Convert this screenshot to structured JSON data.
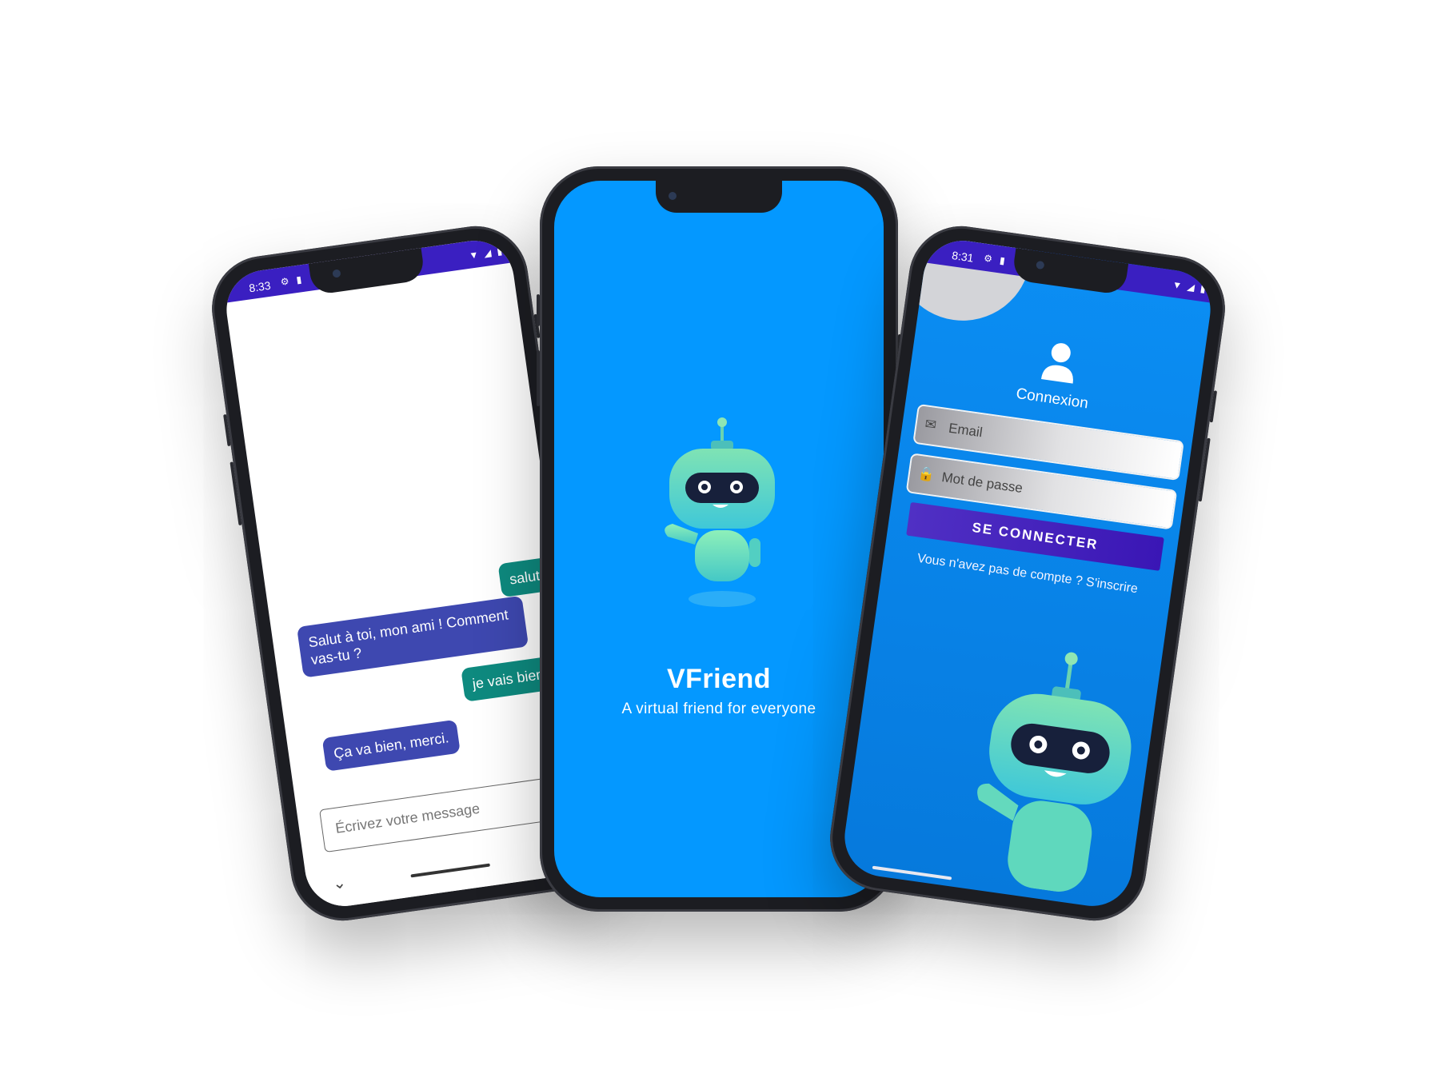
{
  "chat_screen": {
    "status": {
      "time": "8:33"
    },
    "messages": [
      {
        "from": "user",
        "text": "salut mo"
      },
      {
        "from": "bot",
        "text": "Salut à toi, mon ami ! Comment vas-tu ?"
      },
      {
        "from": "user",
        "text": "je vais bien mer"
      },
      {
        "from": "bot",
        "text": "Ça va bien, merci."
      }
    ],
    "input": {
      "placeholder": "Écrivez votre message"
    },
    "nav": {
      "chevron": "⌄"
    }
  },
  "splash_screen": {
    "app_name": "VFriend",
    "tagline": "A virtual friend for everyone",
    "mascot_icon": "robot-mascot"
  },
  "login_screen": {
    "status": {
      "time": "8:31"
    },
    "title": "Connexion",
    "email_placeholder": "Email",
    "password_placeholder": "Mot de passe",
    "button_label": "SE CONNECTER",
    "signup_text": "Vous n'avez pas de compte ? S'inscrire"
  },
  "colors": {
    "primary_blue": "#0498ff",
    "status_purple": "#3a1fc1",
    "user_bubble": "#0e8a7f",
    "bot_bubble": "#3e48b0"
  }
}
